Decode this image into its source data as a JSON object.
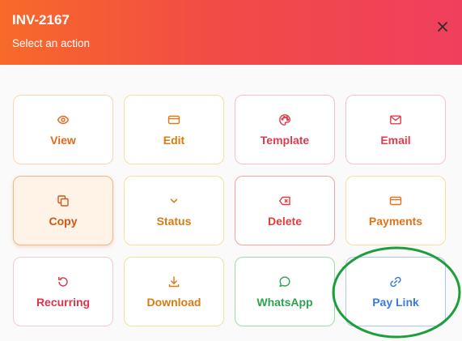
{
  "header": {
    "title": "INV-2167",
    "subtitle": "Select an action",
    "close_icon": "close-icon"
  },
  "actions": [
    {
      "label": "View",
      "icon": "eye-icon"
    },
    {
      "label": "Edit",
      "icon": "card-icon"
    },
    {
      "label": "Template",
      "icon": "palette-icon"
    },
    {
      "label": "Email",
      "icon": "mail-icon"
    },
    {
      "label": "Copy",
      "icon": "copy-icon"
    },
    {
      "label": "Status",
      "icon": "chevron-down-icon"
    },
    {
      "label": "Delete",
      "icon": "backspace-icon"
    },
    {
      "label": "Payments",
      "icon": "card-icon"
    },
    {
      "label": "Recurring",
      "icon": "rotate-icon"
    },
    {
      "label": "Download",
      "icon": "download-icon"
    },
    {
      "label": "WhatsApp",
      "icon": "chat-bubble-icon"
    },
    {
      "label": "Pay Link",
      "icon": "link-icon"
    }
  ],
  "colors": {
    "header_start": "#f76a2a",
    "header_end": "#ef3f5e",
    "annotation_circle": "#1e9e3a"
  }
}
